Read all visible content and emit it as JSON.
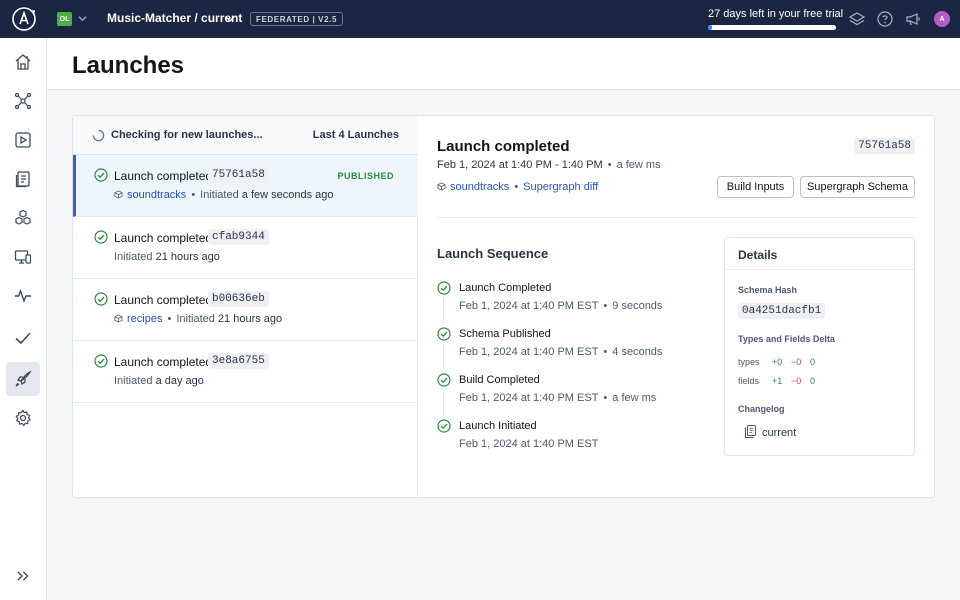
{
  "topbar": {
    "org_initials": "OL",
    "graph_name": "Music-Matcher / current",
    "federation_badge": "FEDERATED | V2.5",
    "trial_text": "27 days left in your free trial",
    "trial_progress_percent": 3,
    "avatar_initials": "A",
    "icons": [
      "apollo-logo-icon",
      "org-chevron-icon",
      "graph-chevron-icon",
      "layers-icon",
      "help-icon",
      "megaphone-icon"
    ]
  },
  "sidebar": {
    "items": [
      {
        "name": "home",
        "icon": "home-icon",
        "active": false
      },
      {
        "name": "schema",
        "icon": "graph-icon",
        "active": false
      },
      {
        "name": "explorer",
        "icon": "play-icon",
        "active": false
      },
      {
        "name": "changelog",
        "icon": "document-icon",
        "active": false
      },
      {
        "name": "subgraphs",
        "icon": "cubes-icon",
        "active": false
      },
      {
        "name": "clients",
        "icon": "monitor-icon",
        "active": false
      },
      {
        "name": "insights",
        "icon": "activity-icon",
        "active": false
      },
      {
        "name": "checks",
        "icon": "check-icon",
        "active": false
      },
      {
        "name": "launches",
        "icon": "rocket-icon",
        "active": true
      },
      {
        "name": "settings",
        "icon": "gear-icon",
        "active": false
      }
    ],
    "expand_icon": "double-chevron-right-icon"
  },
  "page": {
    "title": "Launches"
  },
  "launch_list": {
    "checking_text": "Checking for new launches...",
    "count_text": "Last 4 Launches",
    "published_label": "PUBLISHED",
    "rows": [
      {
        "title": "Launch completed",
        "hash": "75761a58",
        "subgraph": "soundtracks",
        "initiated_label": "Initiated",
        "initiated_when": "a few seconds ago",
        "selected": true,
        "published": true
      },
      {
        "title": "Launch completed",
        "hash": "cfab9344",
        "subgraph": "",
        "initiated_label": "Initiated",
        "initiated_when": "21 hours ago",
        "selected": false,
        "published": false
      },
      {
        "title": "Launch completed",
        "hash": "b00636eb",
        "subgraph": "recipes",
        "initiated_label": "Initiated",
        "initiated_when": "21 hours ago",
        "selected": false,
        "published": false
      },
      {
        "title": "Launch completed",
        "hash": "3e8a6755",
        "subgraph": "",
        "initiated_label": "Initiated",
        "initiated_when": "a day ago",
        "selected": false,
        "published": false
      }
    ]
  },
  "detail": {
    "title": "Launch completed",
    "hash": "75761a58",
    "time_range": "Feb 1, 2024 at 1:40 PM - 1:40 PM",
    "duration": "a few ms",
    "subgraph_link": "soundtracks",
    "diff_link": "Supergraph diff",
    "build_inputs_button": "Build Inputs",
    "supergraph_schema_button": "Supergraph Schema",
    "sequence_title": "Launch Sequence",
    "steps": [
      {
        "title": "Launch Completed",
        "time": "Feb 1, 2024 at 1:40 PM EST",
        "duration": "9 seconds"
      },
      {
        "title": "Schema Published",
        "time": "Feb 1, 2024 at 1:40 PM EST",
        "duration": "4 seconds"
      },
      {
        "title": "Build Completed",
        "time": "Feb 1, 2024 at 1:40 PM EST",
        "duration": "a few ms"
      },
      {
        "title": "Launch Initiated",
        "time": "Feb 1, 2024 at 1:40 PM EST",
        "duration": ""
      }
    ]
  },
  "details_panel": {
    "title": "Details",
    "schema_hash_label": "Schema Hash",
    "schema_hash": "0a4251dacfb1",
    "delta_label": "Types and Fields Delta",
    "types_label": "types",
    "types_added": "+0",
    "types_removed": "−0",
    "types_changed": "0",
    "fields_label": "fields",
    "fields_added": "+1",
    "fields_removed": "−0",
    "fields_changed": "0",
    "changelog_label": "Changelog",
    "changelog_value": "current"
  },
  "colors": {
    "topbar_bg": "#1a2642",
    "accent_link": "#2754c5",
    "success_green": "#2c8a3d",
    "removed_red": "#c94a44",
    "selected_row_bg": "#eef5fc",
    "selected_indicator": "#3f5ccf",
    "org_badge": "#4cb140",
    "avatar": "#b45cc8"
  }
}
